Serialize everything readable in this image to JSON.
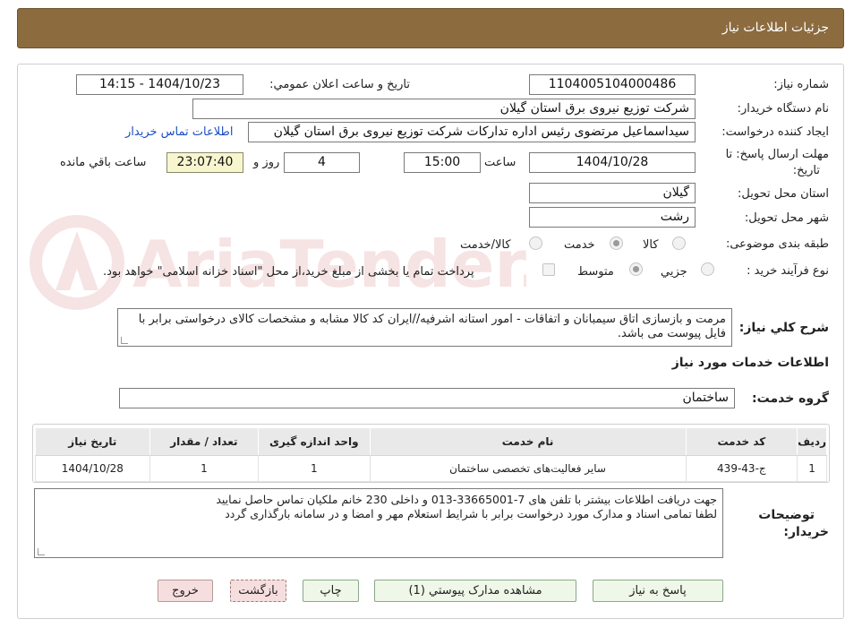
{
  "header": {
    "title": "جزئیات اطلاعات نیاز"
  },
  "fields": {
    "need_number_label": "شماره نیاز:",
    "need_number": "1104005104000486",
    "announce_label": "تاریخ و ساعت اعلان عمومي:",
    "announce_value": "1404/10/23 - 14:15",
    "buyer_label": "نام دستگاه خريدار:",
    "buyer_value": "شرکت توزیع نیروی برق استان گیلان",
    "creator_label": "ايجاد کننده درخواست:",
    "creator_value": "سیداسماعیل مرتضوی رئیس اداره تدارکات شرکت توزیع نیروی برق استان گیلان",
    "contact_link": "اطلاعات تماس خريدار",
    "deadline_label_1": "مهلت ارسال پاسخ: تا",
    "deadline_label_2": "تاريخ:",
    "deadline_date": "1404/10/28",
    "time_label": "ساعت",
    "deadline_time": "15:00",
    "days_value": "4",
    "days_label": "روز و",
    "remaining_time": "23:07:40",
    "remaining_label": "ساعت باقي مانده",
    "province_label": "استان محل تحويل:",
    "province_value": "گیلان",
    "city_label": "شهر محل تحويل:",
    "city_value": "رشت",
    "category_label": "طبقه بندی موضوعی:",
    "category_options": [
      "کالا",
      "خدمت",
      "کالا/خدمت"
    ],
    "category_selected": "خدمت",
    "process_label": "نوع فرآیند خرید :",
    "process_options": [
      "جزيي",
      "متوسط"
    ],
    "process_selected": "متوسط",
    "payment_note": "پرداخت تمام یا بخشی از مبلغ خرید،از محل \"اسناد خزانه اسلامی\" خواهد بود."
  },
  "description": {
    "label": "شرح کلي نياز:",
    "text": "مرمت و بازسازی اتاق سیمبانان و اتفاقات - امور استانه اشرفیه//ایران کد کالا مشابه و مشخصات کالای درخواستی برابر با فایل پیوست می باشد."
  },
  "services": {
    "section_title": "اطلاعات خدمات مورد نياز",
    "group_label": "گروه خدمت:",
    "group_value": "ساختمان",
    "columns": [
      "رديف",
      "کد خدمت",
      "نام خدمت",
      "واحد اندازه گيری",
      "تعداد / مقدار",
      "تاريخ نياز"
    ],
    "rows": [
      [
        "1",
        "ج-43-439",
        "سایر فعالیت‌های تخصصی ساختمان",
        "1",
        "1",
        "1404/10/28"
      ]
    ]
  },
  "notes": {
    "label_1": "توضيحات",
    "label_2": "خريدار:",
    "line_1": "جهت دریافت اطلاعات بیشتر با تلفن های 7-33665001-013 و داخلی 230 خانم ملکیان تماس حاصل نمایید",
    "line_2": "لطفا تمامی اسناد و مدارک مورد درخواست برابر با شرایط استعلام مهر و امضا و در سامانه بارگذاری گردد"
  },
  "buttons": {
    "reply": "پاسخ به نياز",
    "attachments": "مشاهده مدارک پيوستي (1)",
    "print": "چاپ",
    "back": "بازگشت",
    "exit": "خروج"
  },
  "watermark_text": "AriaTender.neT",
  "colors": {
    "header": "#8c6b3f",
    "link": "#1a4fc2",
    "remaining_bg": "#f8f6cf"
  }
}
